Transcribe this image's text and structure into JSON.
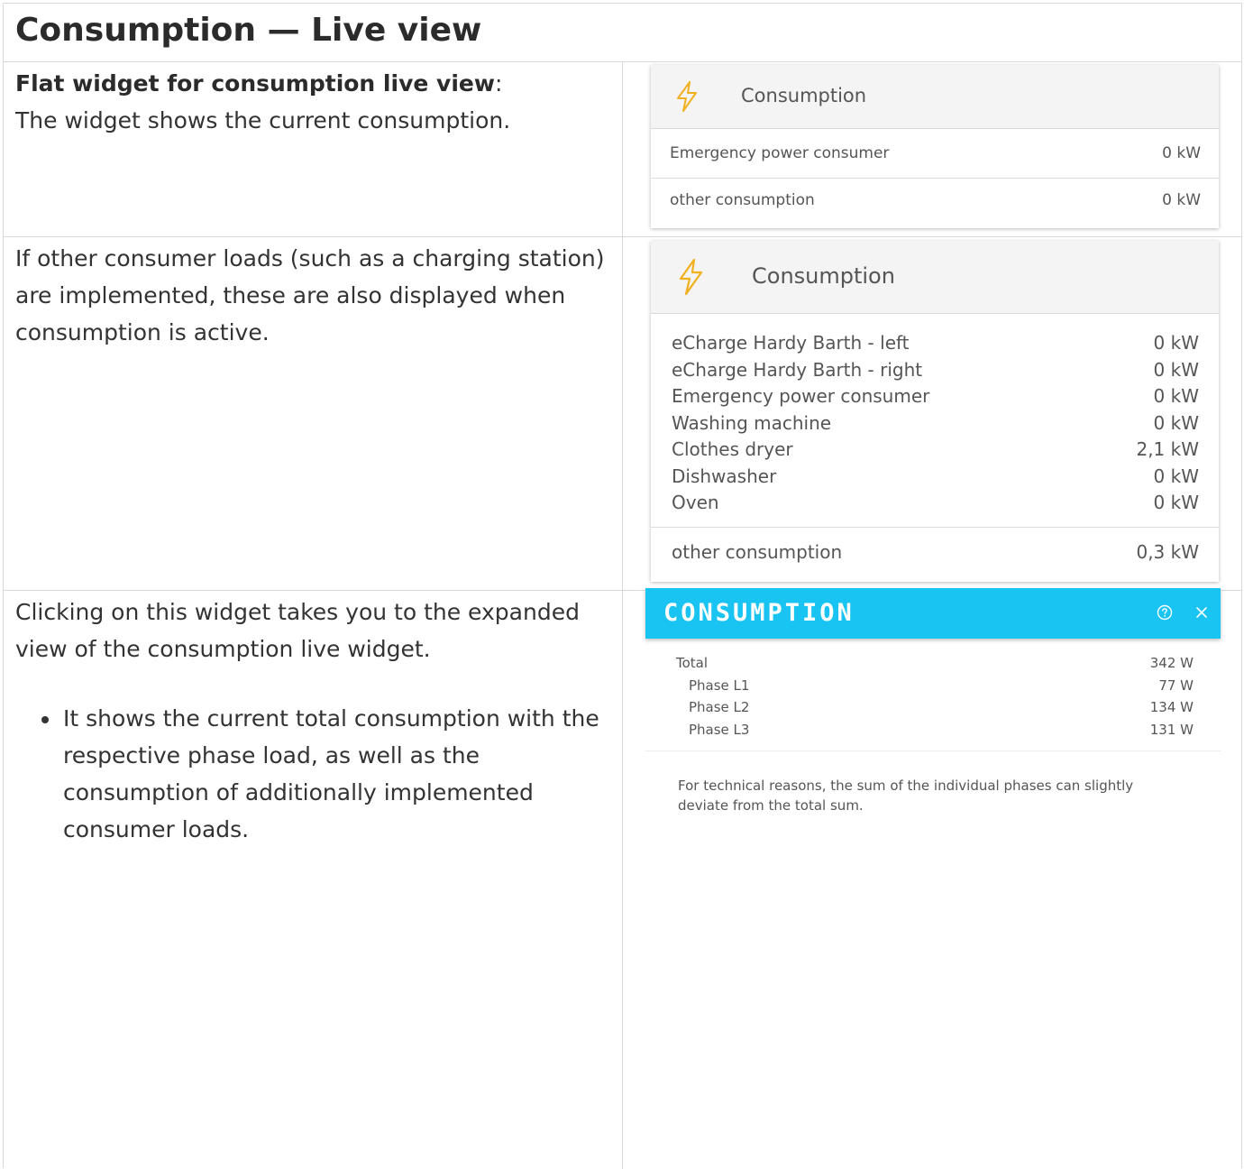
{
  "page": {
    "title": "Consumption — Live view"
  },
  "section1": {
    "heading": "Flat widget for consumption live view",
    "heading_suffix": ":",
    "text": "The widget shows the current consumption."
  },
  "section2": {
    "text": "If other consumer loads (such as a charging station) are implemented, these are also displayed when consumption is active."
  },
  "section3": {
    "text": "Clicking on this widget takes you to the expanded view of the consumption live widget.",
    "bullets": [
      "It shows the current total consumption with the respective phase load, as well as the consumption of additionally implemented consumer loads."
    ]
  },
  "widget_small": {
    "title": "Consumption",
    "icon": "lightning-bolt-icon",
    "rows": [
      {
        "label": "Emergency power consumer",
        "value": "0 kW"
      },
      {
        "label": "other consumption",
        "value": "0 kW"
      }
    ]
  },
  "widget_large": {
    "title": "Consumption",
    "icon": "lightning-bolt-icon",
    "consumers": [
      {
        "label": "eCharge Hardy Barth - left",
        "value": "0 kW"
      },
      {
        "label": "eCharge Hardy Barth - right",
        "value": "0 kW"
      },
      {
        "label": "Emergency power consumer",
        "value": "0 kW"
      },
      {
        "label": "Washing machine",
        "value": "0 kW"
      },
      {
        "label": "Clothes dryer",
        "value": "2,1 kW"
      },
      {
        "label": "Dishwasher",
        "value": "0 kW"
      },
      {
        "label": "Oven",
        "value": "0 kW"
      }
    ],
    "other": {
      "label": "other consumption",
      "value": "0,3 kW"
    }
  },
  "expanded": {
    "title": "CONSUMPTION",
    "help_icon": "help-circle-icon",
    "close_icon": "close-icon",
    "total": {
      "label": "Total",
      "value": "342 W"
    },
    "phases": [
      {
        "label": "Phase L1",
        "value": "77 W"
      },
      {
        "label": "Phase L2",
        "value": "134 W"
      },
      {
        "label": "Phase L3",
        "value": "131 W"
      }
    ],
    "note": "For technical reasons, the sum of the individual phases can slightly deviate from the total sum."
  },
  "colors": {
    "accent": "#19c3f2",
    "bolt": "#f2b01e"
  }
}
